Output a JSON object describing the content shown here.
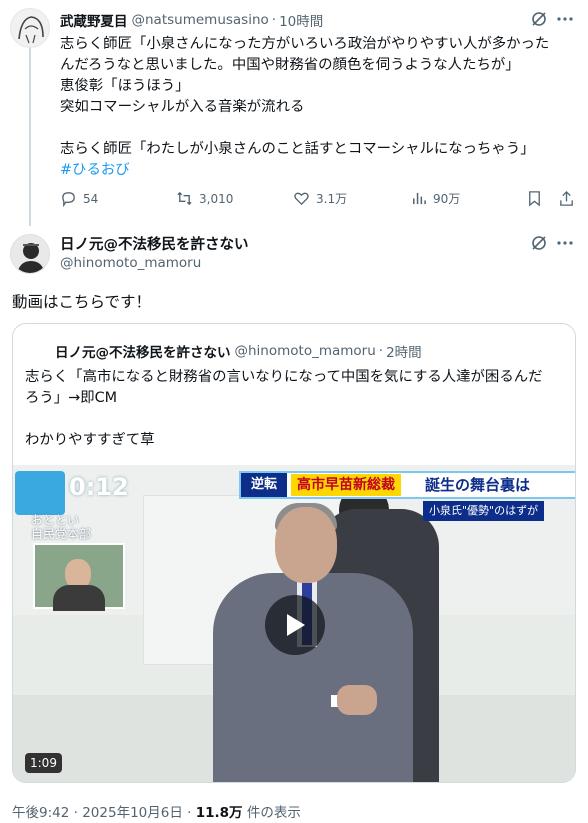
{
  "tweet1": {
    "name": "武蔵野夏目",
    "handle": "@natsumemusasino",
    "dot": "·",
    "time": "10時間",
    "lines": [
      "志らく師匠「小泉さんになった方がいろいろ政治がやりやすい人が多かった",
      "んだろうなと思いました。中国や財務省の顔色を伺うような人たちが」",
      "恵俊彰「ほうほう」",
      "突如コマーシャルが入る音楽が流れる",
      "",
      "志らく師匠「わたしが小泉さんのこと話すとコマーシャルになっちゃう」"
    ],
    "hashtag": "#ひるおび",
    "actions": {
      "replies": "54",
      "retweets": "3,010",
      "likes": "3.1万",
      "views": "90万"
    },
    "icons": [
      "grok-icon",
      "more-icon",
      "reply-icon",
      "retweet-icon",
      "like-icon",
      "views-icon",
      "bookmark-icon",
      "share-icon"
    ]
  },
  "tweet2": {
    "name": "日ノ元@不法移民を許さない",
    "handle": "@hinomoto_mamoru",
    "text": "動画はこちらです！",
    "quote": {
      "name": "日ノ元@不法移民を許さない",
      "handle": "@hinomoto_mamoru",
      "dot": "·",
      "time": "2時間",
      "lines": [
        "志らく「高市になると財務省の言いなりになって中国を気にする人達が困るんだ",
        "ろう」→即CM",
        "",
        "わかりやすすぎて草"
      ],
      "video": {
        "tv_time": "0:12",
        "tv_sub1": "おととい",
        "tv_sub2": "自民党本部",
        "chyron_tag": "逆転",
        "chyron_name": "高市早苗新総裁",
        "chyron_main": "誕生の舞台裏は",
        "chyron_sub": "小泉氏\"優勢\"のはずが",
        "duration": "1:09"
      }
    },
    "footer": {
      "time": "午後9:42",
      "dot": "·",
      "date": "2025年10月6日",
      "views": "11.8万",
      "views_label": "件の表示"
    }
  },
  "colors": {
    "link": "#1d9bf0",
    "secondary": "#536471",
    "border": "#cfd9de"
  }
}
